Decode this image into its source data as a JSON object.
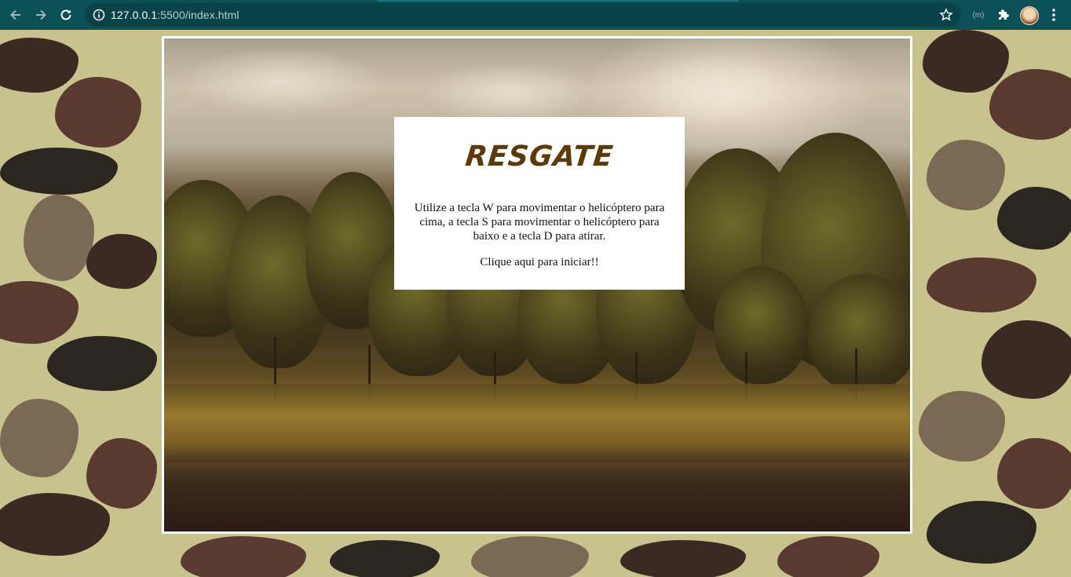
{
  "browser": {
    "url_host": "127.0.0.1",
    "url_rest": ":5500/index.html",
    "extension_badge": "(m)"
  },
  "game": {
    "title": "RESGATE",
    "instructions": "Utilize a tecla W para movimentar o helicóptero para cima, a tecla S para movimentar o helicóptero para baixo e a tecla D para atirar.",
    "start_text": "Clique aqui para iniciar!!"
  },
  "colors": {
    "chrome": "#0b4f57",
    "title": "#5b3a0c",
    "frame": "#ffffff"
  }
}
